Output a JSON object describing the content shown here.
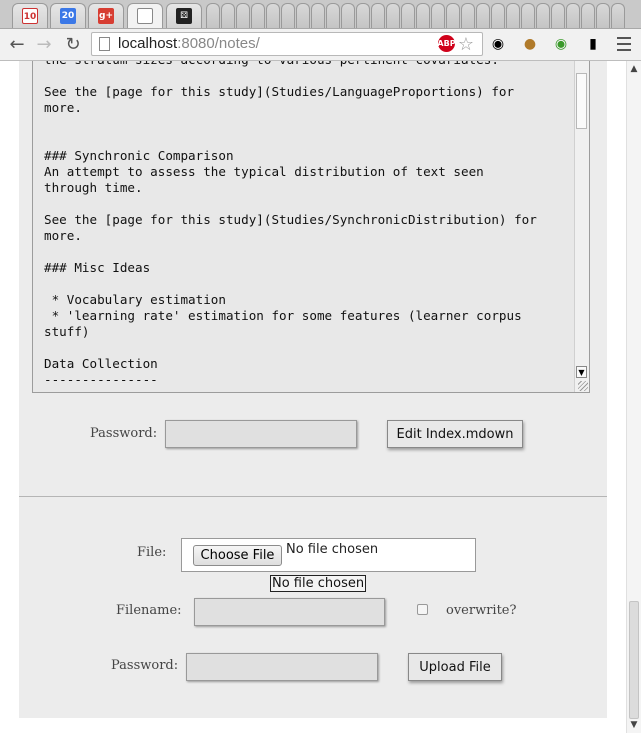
{
  "browser": {
    "tabs": [
      {
        "icon": "gmail-icon",
        "badge": "10"
      },
      {
        "icon": "calendar-icon",
        "badge": "20"
      },
      {
        "icon": "google-plus-icon",
        "badge": "g+"
      },
      {
        "icon": "blank-page-icon",
        "badge": ""
      },
      {
        "icon": "dice-icon",
        "badge": ""
      }
    ],
    "url_host": "localhost",
    "url_path": ":8080/notes/",
    "extensions": [
      "adblock-icon",
      "incognito-mask-icon",
      "cookie-icon",
      "globe-icon",
      "phone-icon"
    ],
    "adblock_label": "ABP"
  },
  "editor": {
    "content": "the stratum sizes according to various pertinent covariates.\n\nSee the [page for this study](Studies/LanguageProportions) for\nmore.\n\n\n### Synchronic Comparison\nAn attempt to assess the typical distribution of text seen\nthrough time.\n\nSee the [page for this study](Studies/SynchronicDistribution) for\nmore.\n\n### Misc Ideas\n\n * Vocabulary estimation\n * 'learning rate' estimation for some features (learner corpus\nstuff)\n\nData Collection\n---------------"
  },
  "edit_form": {
    "password_label": "Password:",
    "submit_label": "Edit Index.mdown"
  },
  "upload_form": {
    "file_label": "File:",
    "choose_button_label": "Choose File",
    "file_status": "No file chosen",
    "tooltip": "No file chosen",
    "filename_label": "Filename:",
    "overwrite_label": "overwrite?",
    "overwrite_checked": false,
    "password_label": "Password:",
    "submit_label": "Upload File"
  }
}
